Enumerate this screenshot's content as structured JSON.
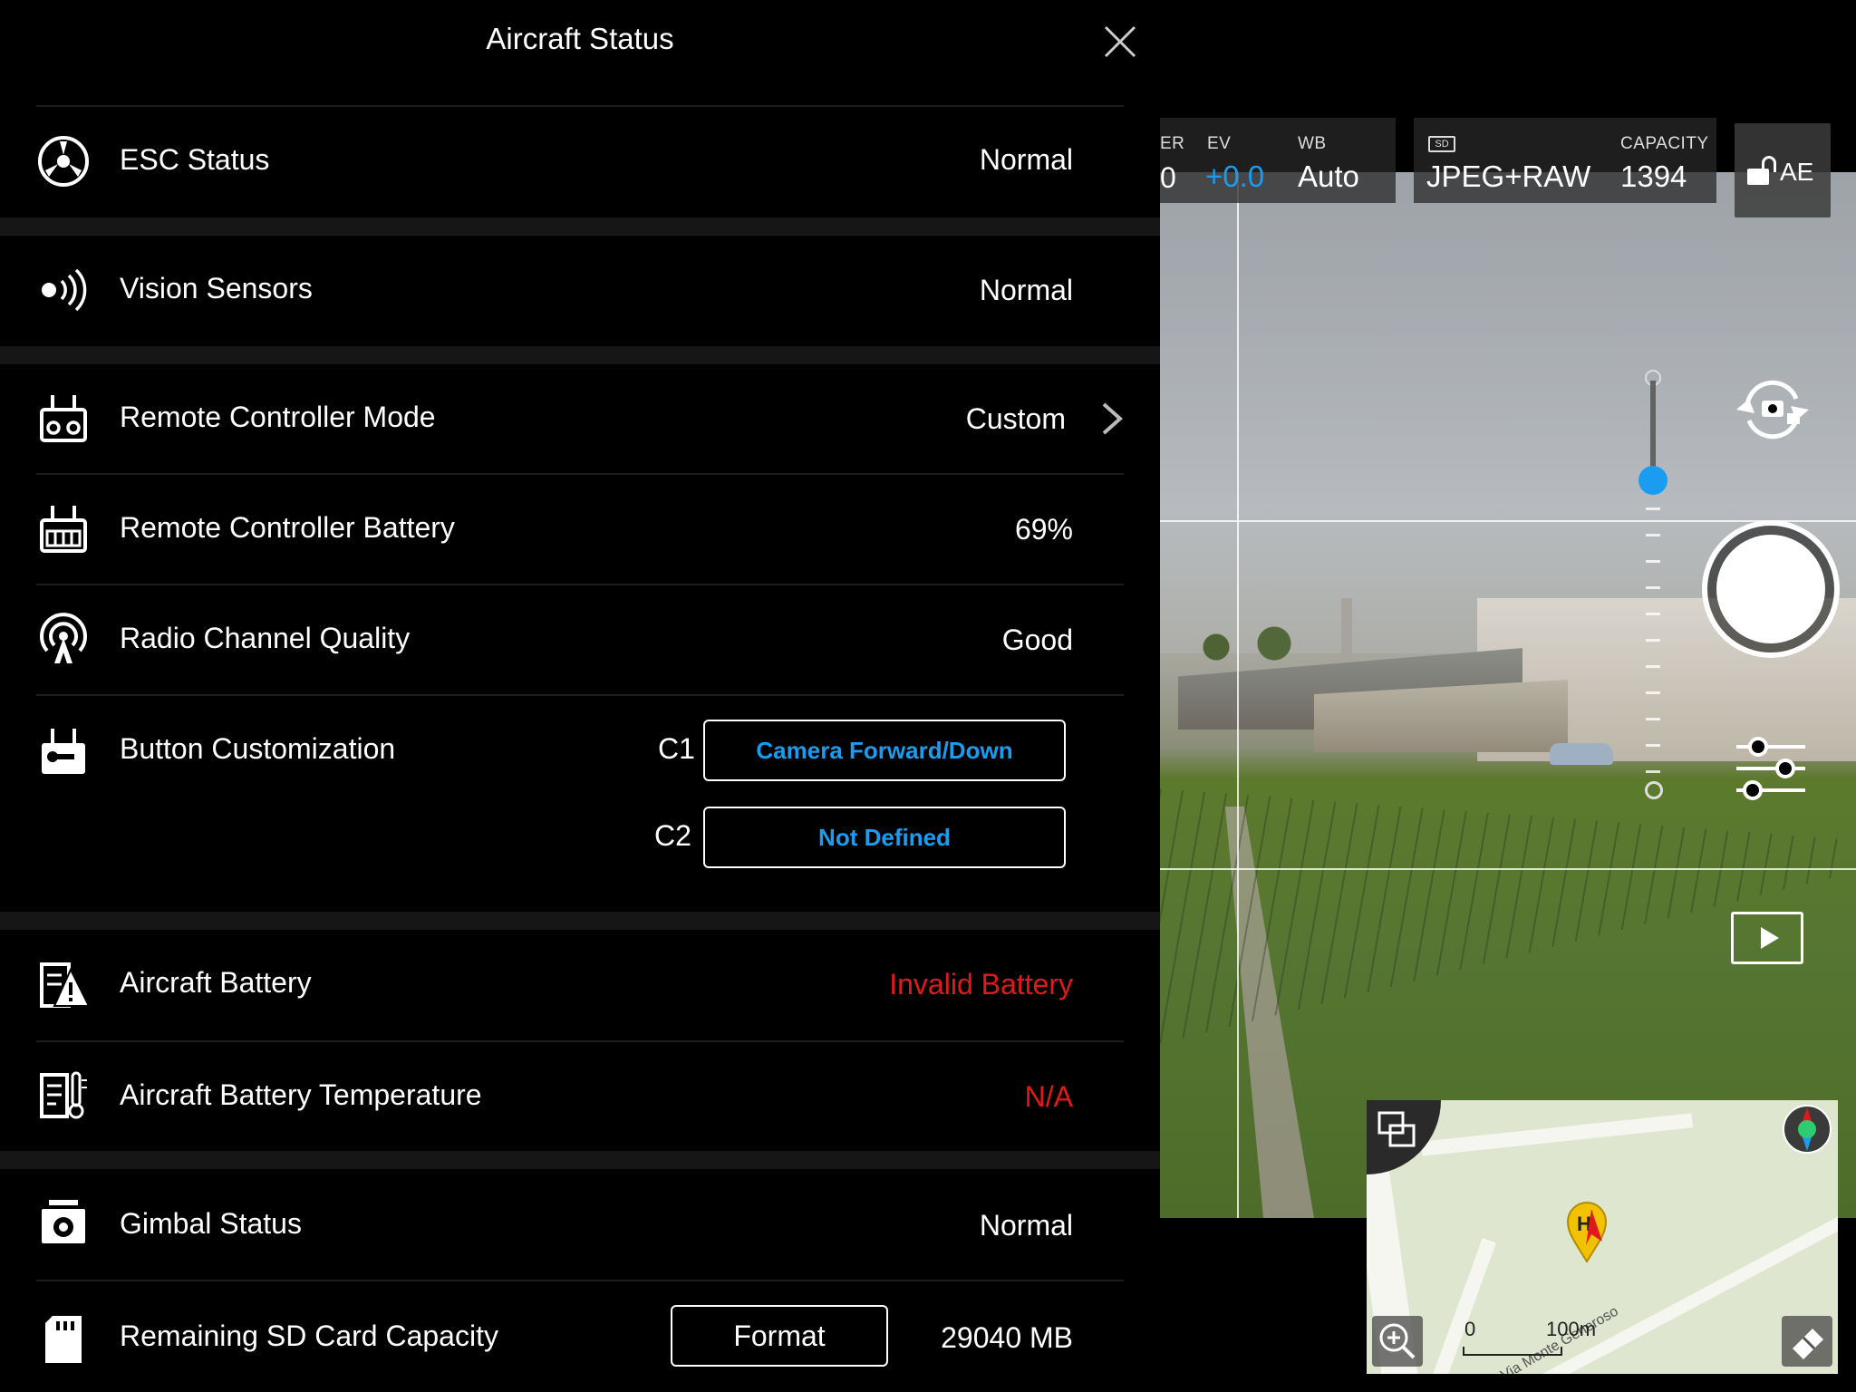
{
  "panel": {
    "title": "Aircraft Status",
    "rows": {
      "esc": {
        "label": "ESC Status",
        "value": "Normal"
      },
      "vision": {
        "label": "Vision Sensors",
        "value": "Normal"
      },
      "rc_mode": {
        "label": "Remote Controller Mode",
        "value": "Custom"
      },
      "rc_battery": {
        "label": "Remote Controller Battery",
        "value": "69%"
      },
      "radio": {
        "label": "Radio Channel Quality",
        "value": "Good"
      },
      "buttons": {
        "label": "Button Customization",
        "c1_label": "C1",
        "c1_value": "Camera Forward/Down",
        "c2_label": "C2",
        "c2_value": "Not Defined"
      },
      "aircraft_battery": {
        "label": "Aircraft Battery",
        "value": "Invalid Battery"
      },
      "battery_temp": {
        "label": "Aircraft Battery Temperature",
        "value": "N/A"
      },
      "gimbal": {
        "label": "Gimbal Status",
        "value": "Normal"
      },
      "sd_card": {
        "label": "Remaining SD Card Capacity",
        "format_label": "Format",
        "value": "29040 MB"
      }
    }
  },
  "camera": {
    "shutter_partial": "ER",
    "iso_partial": "0",
    "ev_label": "EV",
    "ev_value": "+0.0",
    "wb_label": "WB",
    "wb_value": "Auto",
    "sd_badge": "SD",
    "format_value": "JPEG+RAW",
    "capacity_label": "CAPACITY",
    "capacity_value": "1394",
    "ae_label": "AE"
  },
  "map": {
    "scale_start": "0",
    "scale_end": "100m",
    "street_name": "Via Monte Generoso"
  },
  "colors": {
    "accent_blue": "#1a9cf0",
    "warning_red": "#e01a1a",
    "panel_bg": "#000000"
  },
  "icons": [
    "esc-icon",
    "vision-sensor-icon",
    "remote-controller-icon",
    "rc-battery-icon",
    "radio-signal-icon",
    "button-custom-icon",
    "aircraft-battery-icon",
    "battery-temperature-icon",
    "gimbal-icon",
    "sd-card-icon",
    "close-icon",
    "chevron-right-icon",
    "camera-switch-icon",
    "settings-sliders-icon",
    "play-icon",
    "compass-icon",
    "home-point-icon",
    "map-zoom-icon",
    "eraser-icon",
    "lock-icon"
  ]
}
